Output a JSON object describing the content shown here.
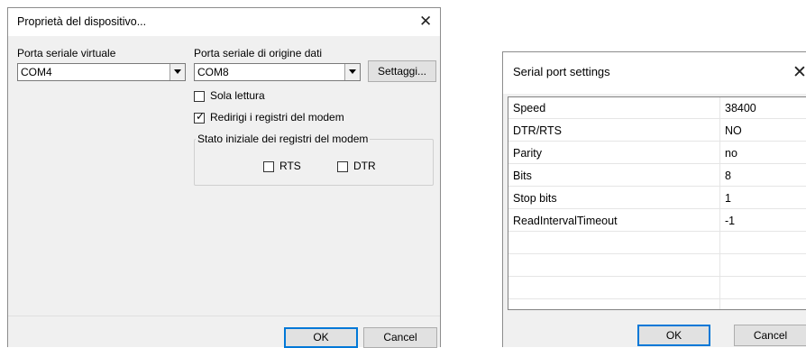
{
  "device_dialog": {
    "title": "Proprietà del dispositivo...",
    "close_glyph": "✕",
    "virtual_port": {
      "label": "Porta seriale virtuale",
      "value": "COM4"
    },
    "source_port": {
      "label": "Porta seriale di origine dati",
      "value": "COM8"
    },
    "settings_button": "Settaggi...",
    "read_only": {
      "label": "Sola lettura",
      "checked": false
    },
    "redirect_modem": {
      "label": "Redirigi i registri del modem",
      "checked": true
    },
    "initial_state": {
      "title": "Stato iniziale dei registri del modem",
      "rts": {
        "label": "RTS",
        "checked": false
      },
      "dtr": {
        "label": "DTR",
        "checked": false
      }
    },
    "ok_label": "OK",
    "cancel_label": "Cancel",
    "check_glyph": "✓"
  },
  "serial_dialog": {
    "title": "Serial port settings",
    "close_glyph": "✕",
    "rows": [
      {
        "name": "Speed",
        "value": "38400"
      },
      {
        "name": "DTR/RTS",
        "value": "NO"
      },
      {
        "name": "Parity",
        "value": "no"
      },
      {
        "name": "Bits",
        "value": "8"
      },
      {
        "name": "Stop bits",
        "value": "1"
      },
      {
        "name": "ReadIntervalTimeout",
        "value": "-1"
      }
    ],
    "ok_label": "OK",
    "cancel_label": "Cancel"
  }
}
